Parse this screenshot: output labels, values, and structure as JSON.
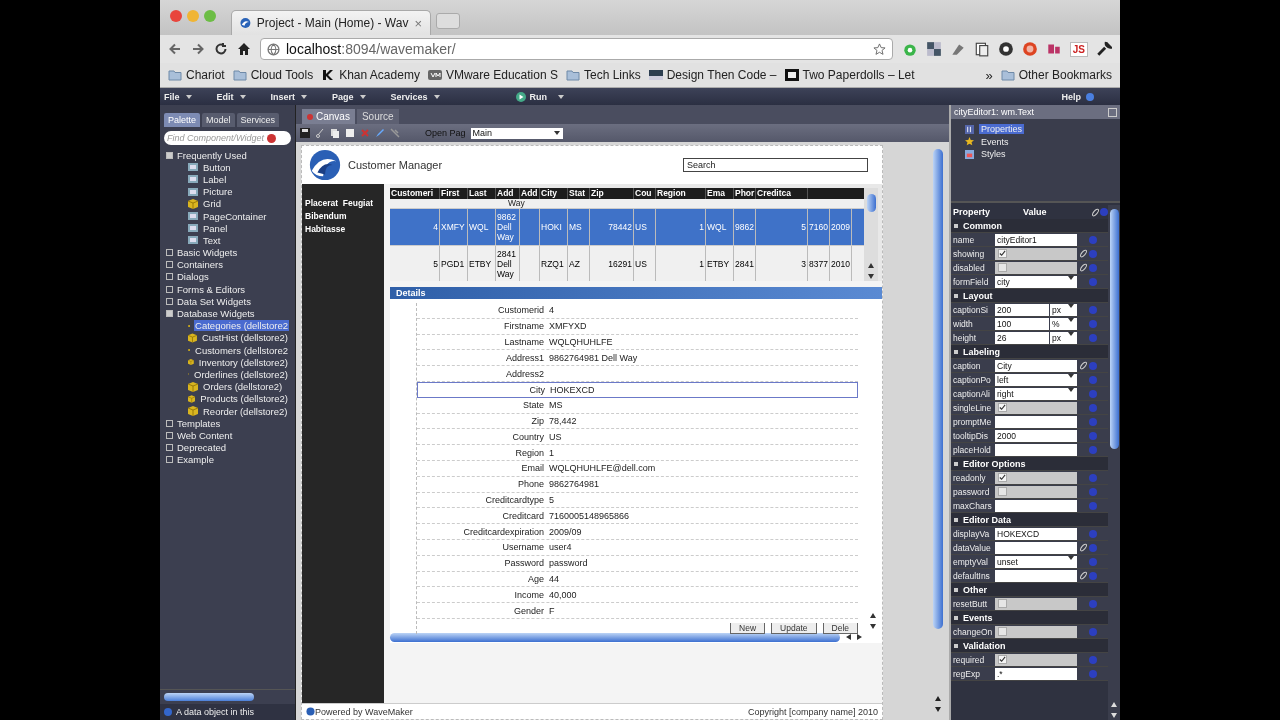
{
  "browser": {
    "tab": {
      "title": "Project - Main (Home) - Wav",
      "close": "×"
    },
    "url": {
      "host": "localhost",
      "rest": ":8094/wavemaker/"
    },
    "extension_label": "JS",
    "bookmarks": [
      {
        "label": "Chariot",
        "kind": "folder"
      },
      {
        "label": "Cloud Tools",
        "kind": "folder"
      },
      {
        "label": "Khan Academy",
        "kind": "k"
      },
      {
        "label": "VMware Education S",
        "kind": "vm"
      },
      {
        "label": "Tech Links",
        "kind": "folder"
      },
      {
        "label": "Design Then Code –",
        "kind": "page"
      },
      {
        "label": "Two Paperdolls – Let",
        "kind": "tpd"
      }
    ],
    "more_bookmarks": "»",
    "other_bookmarks": "Other Bookmarks"
  },
  "menu": {
    "items": [
      "File",
      "Edit",
      "Insert",
      "Page",
      "Services"
    ],
    "run": "Run",
    "help": "Help"
  },
  "palette": {
    "tabs": [
      {
        "label": "Palette",
        "selected": true
      },
      {
        "label": "Model",
        "selected": false
      },
      {
        "label": "Services",
        "selected": false
      }
    ],
    "search": {
      "placeholder": "Find Component/Widget"
    },
    "tree": [
      {
        "label": "Frequently Used",
        "expanded": true,
        "children": [
          {
            "label": "Button",
            "kind": "widget",
            "selected": false
          },
          {
            "label": "Label",
            "kind": "widget",
            "selected": false
          },
          {
            "label": "Picture",
            "kind": "widget",
            "selected": false
          },
          {
            "label": "Grid",
            "kind": "table",
            "selected": false
          },
          {
            "label": "PageContainer",
            "kind": "widget",
            "selected": false
          },
          {
            "label": "Panel",
            "kind": "widget",
            "selected": false
          },
          {
            "label": "Text",
            "kind": "widget",
            "selected": false
          }
        ]
      },
      {
        "label": "Basic Widgets",
        "expanded": false
      },
      {
        "label": "Containers",
        "expanded": false
      },
      {
        "label": "Dialogs",
        "expanded": false
      },
      {
        "label": "Forms & Editors",
        "expanded": false
      },
      {
        "label": "Data Set Widgets",
        "expanded": false
      },
      {
        "label": "Database Widgets",
        "expanded": true,
        "children": [
          {
            "label": "Categories (dellstore2",
            "kind": "table",
            "selected": true
          },
          {
            "label": "CustHist (dellstore2)",
            "kind": "table",
            "selected": false
          },
          {
            "label": "Customers (dellstore2",
            "kind": "table",
            "selected": false
          },
          {
            "label": "Inventory (dellstore2)",
            "kind": "table",
            "selected": false
          },
          {
            "label": "Orderlines (dellstore2)",
            "kind": "table",
            "selected": false
          },
          {
            "label": "Orders (dellstore2)",
            "kind": "table",
            "selected": false
          },
          {
            "label": "Products (dellstore2)",
            "kind": "table",
            "selected": false
          },
          {
            "label": "Reorder (dellstore2)",
            "kind": "table",
            "selected": false
          }
        ]
      },
      {
        "label": "Templates",
        "expanded": false
      },
      {
        "label": "Web Content",
        "expanded": false
      },
      {
        "label": "Deprecated",
        "expanded": false
      },
      {
        "label": "Example",
        "expanded": false
      }
    ],
    "status": "A data object in this"
  },
  "canvas": {
    "tabs": [
      {
        "label": "Canvas",
        "selected": true
      },
      {
        "label": "Source",
        "selected": false
      }
    ],
    "open_page_label": "Open Pag",
    "open_page_value": "Main",
    "page": {
      "title": "Customer Manager",
      "search_value": "Search",
      "nav": [
        "Placerat  Feugiat",
        "Bibendum",
        "Habitasse"
      ],
      "grid": {
        "columns": [
          "Customeri",
          "First",
          "Last",
          "Add",
          "Add",
          "City",
          "Stat",
          "Zip",
          "Cou",
          "Region",
          "Ema",
          "Phor",
          "Creditca"
        ],
        "partial_row": "Way",
        "rows": [
          {
            "selected": true,
            "cells": [
              "4",
              "XMFY",
              "WQL",
              "9862 Dell Way",
              "",
              "HOKI",
              "MS",
              "78442",
              "US",
              "1",
              "WQL",
              "9862",
              "5",
              "7160",
              "2009"
            ]
          },
          {
            "selected": false,
            "cells": [
              "5",
              "PGD1",
              "ETBY",
              "2841 Dell Way",
              "",
              "RZQ1",
              "AZ",
              "16291",
              "US",
              "1",
              "ETBY",
              "2841",
              "3",
              "8377",
              "2010"
            ]
          }
        ]
      },
      "details": {
        "title": "Details",
        "fields": [
          {
            "label": "Customerid",
            "value": "4",
            "selected": false
          },
          {
            "label": "Firstname",
            "value": "XMFYXD",
            "selected": false
          },
          {
            "label": "Lastname",
            "value": "WQLQHUHLFE",
            "selected": false
          },
          {
            "label": "Address1",
            "value": "9862764981 Dell Way",
            "selected": false
          },
          {
            "label": "Address2",
            "selected": false
          },
          {
            "label": "City",
            "value": "HOKEXCD",
            "selected": true
          },
          {
            "label": "State",
            "value": "MS",
            "selected": false
          },
          {
            "label": "Zip",
            "value": "78,442",
            "selected": false
          },
          {
            "label": "Country",
            "value": "US",
            "selected": false
          },
          {
            "label": "Region",
            "value": "1",
            "selected": false
          },
          {
            "label": "Email",
            "value": "WQLQHUHLFE@dell.com",
            "selected": false
          },
          {
            "label": "Phone",
            "value": "9862764981",
            "selected": false
          },
          {
            "label": "Creditcardtype",
            "value": "5",
            "selected": false
          },
          {
            "label": "Creditcard",
            "value": "7160005148965866",
            "selected": false
          },
          {
            "label": "Creditcardexpiration",
            "value": "2009/09",
            "selected": false
          },
          {
            "label": "Username",
            "value": "user4",
            "selected": false
          },
          {
            "label": "Password",
            "value": "password",
            "selected": false
          },
          {
            "label": "Age",
            "value": "44",
            "selected": false
          },
          {
            "label": "Income",
            "value": "40,000",
            "selected": false
          },
          {
            "label": "Gender",
            "value": "F",
            "selected": false
          }
        ],
        "buttons": [
          "New",
          "Update",
          "Dele"
        ]
      },
      "footer_left": "Powered by WaveMaker",
      "footer_right": "Copyright [company name] 2010"
    }
  },
  "inspector": {
    "title": "cityEditor1: wm.Text",
    "tree": [
      {
        "label": "Properties",
        "selected": true
      },
      {
        "label": "Events",
        "selected": false
      },
      {
        "label": "Styles",
        "selected": false
      }
    ],
    "header": {
      "property": "Property",
      "value": "Value"
    },
    "groups": [
      {
        "name": "Common",
        "rows": [
          {
            "label": "name",
            "kind": "text",
            "value": "cityEditor1",
            "bindable": false
          },
          {
            "label": "showing",
            "kind": "check",
            "checked": true,
            "bindable": true
          },
          {
            "label": "disabled",
            "kind": "check",
            "checked": false,
            "bindable": true
          },
          {
            "label": "formField",
            "kind": "select",
            "value": "city",
            "bindable": false
          }
        ]
      },
      {
        "name": "Layout",
        "rows": [
          {
            "label": "captionSi",
            "kind": "unit",
            "value": "200",
            "unit": "px",
            "bindable": false
          },
          {
            "label": "width",
            "kind": "unit",
            "value": "100",
            "unit": "%",
            "bindable": false
          },
          {
            "label": "height",
            "kind": "unit",
            "value": "26",
            "unit": "px",
            "bindable": false
          }
        ]
      },
      {
        "name": "Labeling",
        "rows": [
          {
            "label": "caption",
            "kind": "text",
            "value": "City",
            "bindable": true
          },
          {
            "label": "captionPo",
            "kind": "select",
            "value": "left",
            "bindable": false
          },
          {
            "label": "captionAli",
            "kind": "select",
            "value": "right",
            "bindable": false
          },
          {
            "label": "singleLine",
            "kind": "check",
            "checked": true,
            "bindable": false
          },
          {
            "label": "promptMe",
            "kind": "text",
            "bindable": false
          },
          {
            "label": "tooltipDis",
            "kind": "text",
            "value": "2000",
            "bindable": false
          },
          {
            "label": "placeHold",
            "kind": "text",
            "bindable": false
          }
        ]
      },
      {
        "name": "Editor Options",
        "rows": [
          {
            "label": "readonly",
            "kind": "check",
            "checked": true,
            "bindable": false
          },
          {
            "label": "password",
            "kind": "check",
            "checked": false,
            "bindable": false
          },
          {
            "label": "maxChars",
            "kind": "text",
            "bindable": false
          }
        ]
      },
      {
        "name": "Editor Data",
        "rows": [
          {
            "label": "displayVa",
            "kind": "text",
            "value": "HOKEXCD",
            "bindable": false
          },
          {
            "label": "dataValue",
            "kind": "text",
            "bindable": true
          },
          {
            "label": "emptyVal",
            "kind": "select",
            "value": "unset",
            "bindable": false
          },
          {
            "label": "defaultIns",
            "kind": "text",
            "bindable": true
          }
        ]
      },
      {
        "name": "Other",
        "rows": [
          {
            "label": "resetButt",
            "kind": "check",
            "checked": false,
            "bindable": false
          }
        ]
      },
      {
        "name": "Events",
        "rows": [
          {
            "label": "changeOn",
            "kind": "check",
            "checked": false,
            "bindable": false
          }
        ]
      },
      {
        "name": "Validation",
        "rows": [
          {
            "label": "required",
            "kind": "check",
            "checked": true,
            "bindable": false
          },
          {
            "label": "regExp",
            "kind": "text",
            "value": ".*",
            "bindable": false
          }
        ]
      }
    ]
  }
}
